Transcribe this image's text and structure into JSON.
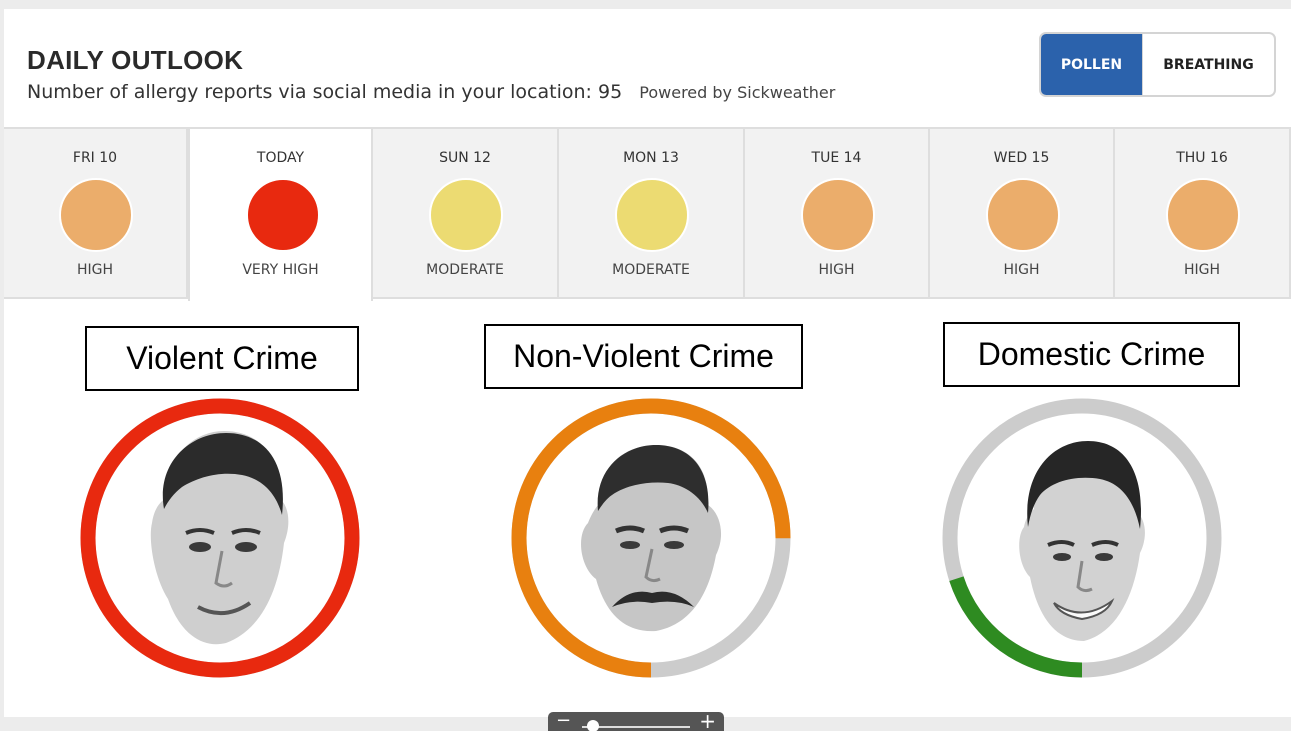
{
  "header": {
    "title": "DAILY OUTLOOK",
    "subtitle": "Number of allergy reports via social media in your location: 95",
    "powered_by": "Powered by Sickweather"
  },
  "toggle": {
    "options": [
      "POLLEN",
      "BREATHING"
    ],
    "selected": "POLLEN",
    "selected_color": "#2b62ac"
  },
  "days": [
    {
      "label": "FRI 10",
      "level": "HIGH",
      "color": "#ebad6b",
      "active": false
    },
    {
      "label": "TODAY",
      "level": "VERY HIGH",
      "color": "#e8290f",
      "active": true
    },
    {
      "label": "SUN 12",
      "level": "MODERATE",
      "color": "#ecdb72",
      "active": false
    },
    {
      "label": "MON 13",
      "level": "MODERATE",
      "color": "#ecdb72",
      "active": false
    },
    {
      "label": "TUE 14",
      "level": "HIGH",
      "color": "#ebad6b",
      "active": false
    },
    {
      "label": "WED 15",
      "level": "HIGH",
      "color": "#ebad6b",
      "active": false
    },
    {
      "label": "THU 16",
      "level": "HIGH",
      "color": "#ebad6b",
      "active": false
    }
  ],
  "crimes": [
    {
      "label": "Violent Crime",
      "level_fraction": 1.0,
      "color": "#e8290f",
      "track_color": "#cccccc",
      "portrait": "portrait-photo"
    },
    {
      "label": "Non-Violent Crime",
      "level_fraction": 0.75,
      "color": "#e8800f",
      "track_color": "#cccccc",
      "portrait": "portrait-photo"
    },
    {
      "label": "Domestic Crime",
      "level_fraction": 0.2,
      "color": "#2e8b21",
      "track_color": "#cccccc",
      "portrait": "portrait-photo"
    }
  ],
  "zoom": {
    "minus_icon": "minus-icon",
    "plus_icon": "plus-icon",
    "minus": "−",
    "plus": "+",
    "level_fraction": 0.05
  }
}
